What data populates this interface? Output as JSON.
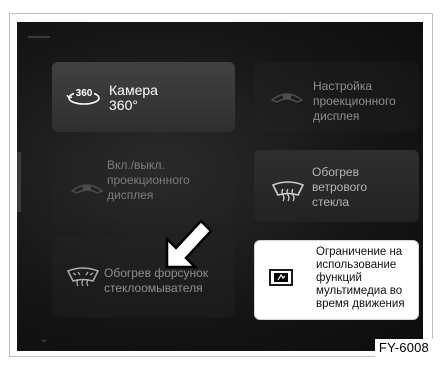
{
  "tiles": {
    "camera": {
      "label": "Камера\n360°",
      "icon": "camera-360-icon",
      "icon_text": "360"
    },
    "hud_settings": {
      "label": "Настройка\nпроекционного\nдисплея",
      "icon": "hud-settings-icon"
    },
    "hud_toggle": {
      "label": "Вкл./выкл.\nпроекционного\nдисплея",
      "icon": "hud-toggle-icon"
    },
    "windshield_heat": {
      "label": "Обогрев\nветрового\nстекла",
      "icon": "windshield-heat-icon"
    },
    "washer_heat": {
      "label": "Обогрев форсунок\nстеклоомывателя",
      "icon": "washer-nozzle-heat-icon"
    },
    "media_limit": {
      "label": "Ограничение на\nиспользование\nфункций\nмультимедиа во\nвремя движения",
      "icon": "media-restriction-icon"
    }
  },
  "figure_code": "FY-6008",
  "colors": {
    "screen_bg": "#151515",
    "tile_active": "#3a3a3a",
    "callout_bg": "#ffffff"
  }
}
